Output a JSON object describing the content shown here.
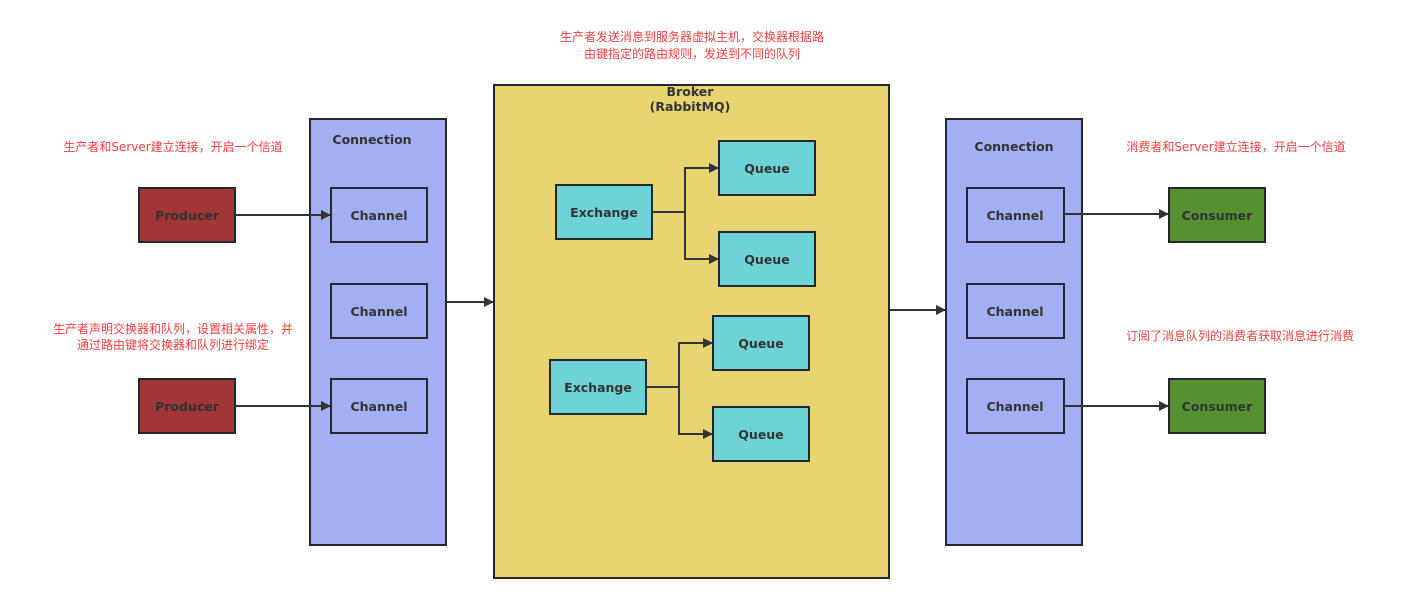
{
  "colors": {
    "producer": "#a13636",
    "consumer": "#559130",
    "connection": "#a4aef3",
    "broker": "#e8d572",
    "exchange_queue": "#6dd3d6",
    "annotation": "#f04040"
  },
  "producers": [
    "Producer",
    "Producer"
  ],
  "left_connection": {
    "label": "Connection",
    "channels": [
      "Channel",
      "Channel",
      "Channel"
    ]
  },
  "broker": {
    "title": "Broker",
    "subtitle": "(RabbitMQ)",
    "groups": [
      {
        "exchange": "Exchange",
        "queues": [
          "Queue",
          "Queue"
        ]
      },
      {
        "exchange": "Exchange",
        "queues": [
          "Queue",
          "Queue"
        ]
      }
    ]
  },
  "right_connection": {
    "label": "Connection",
    "channels": [
      "Channel",
      "Channel",
      "Channel"
    ]
  },
  "consumers": [
    "Consumer",
    "Consumer"
  ],
  "notes": {
    "broker_line1": "生产者发送消息到服务器虚拟主机，交换器根据路",
    "broker_line2": "由键指定的路由规则，发送到不同的队列",
    "producer_connect": "生产者和Server建立连接，开启一个信道",
    "producer_declare_line1": "生产者声明交换器和队列，设置相关属性，并",
    "producer_declare_line2": "通过路由键将交换器和队列进行绑定",
    "consumer_connect": "消费者和Server建立连接，开启一个信道",
    "consumer_subscribe": "订阅了消息队列的消费者获取消息进行消费"
  }
}
